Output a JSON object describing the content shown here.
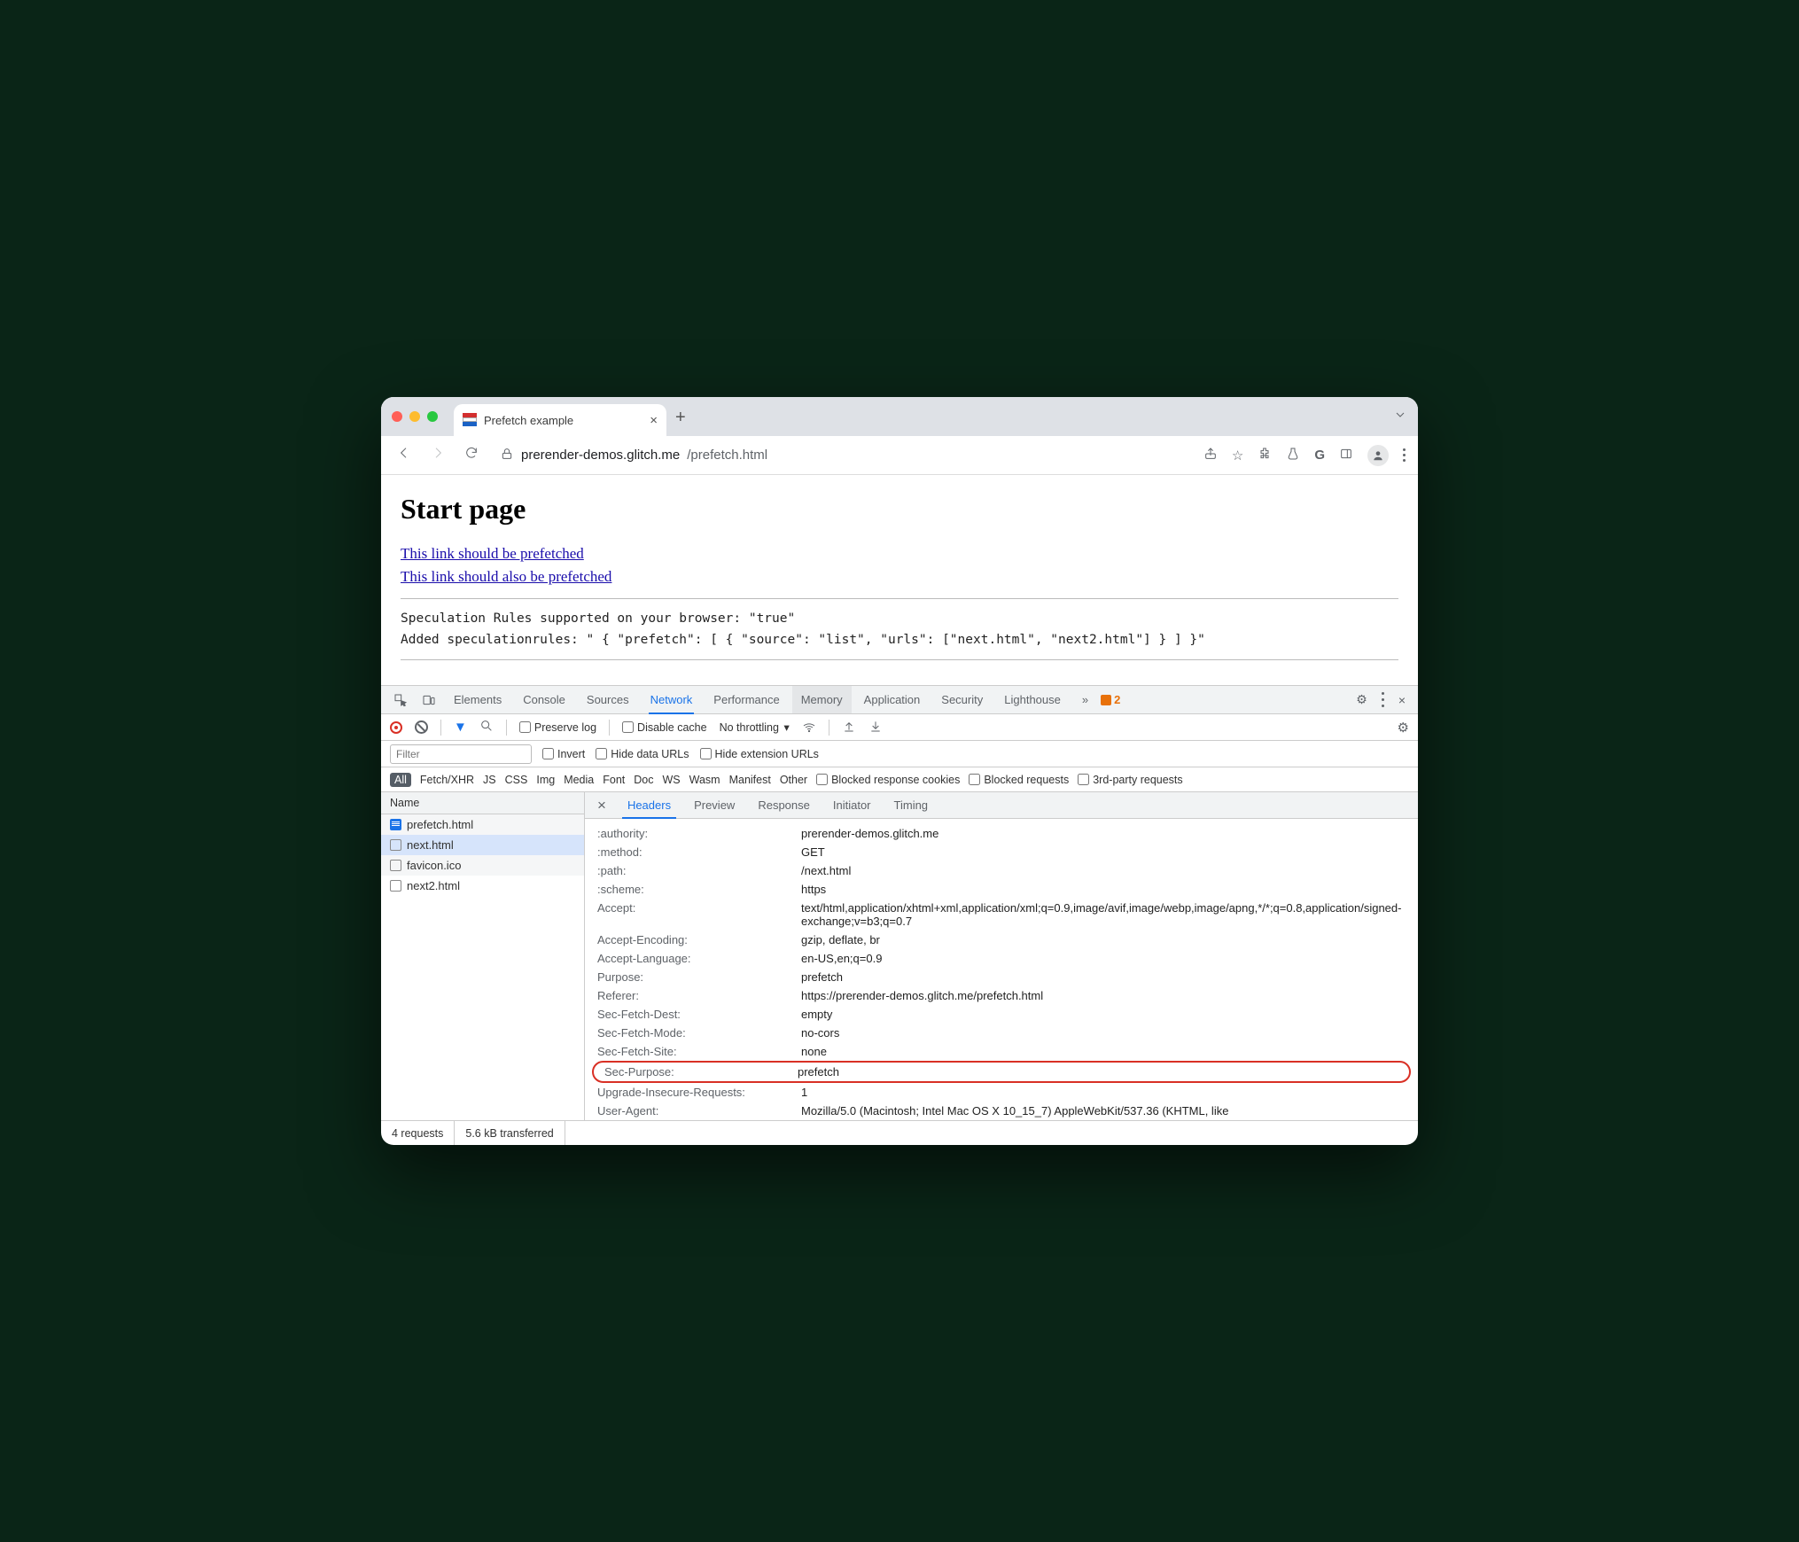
{
  "browser": {
    "tab_title": "Prefetch example",
    "url_host": "prerender-demos.glitch.me",
    "url_path": "/prefetch.html"
  },
  "page": {
    "heading": "Start page",
    "link1": "This link should be prefetched",
    "link2": "This link should also be prefetched",
    "mono1": "Speculation Rules supported on your browser: \"true\"",
    "mono2": "Added speculationrules: \" { \"prefetch\": [ { \"source\": \"list\", \"urls\": [\"next.html\", \"next2.html\"] } ] }\""
  },
  "devtools": {
    "tabs": {
      "elements": "Elements",
      "console": "Console",
      "sources": "Sources",
      "network": "Network",
      "performance": "Performance",
      "memory": "Memory",
      "application": "Application",
      "security": "Security",
      "lighthouse": "Lighthouse"
    },
    "more": "»",
    "warn_count": "2",
    "preserve_log": "Preserve log",
    "disable_cache": "Disable cache",
    "throttling": "No throttling",
    "filter_placeholder": "Filter",
    "invert": "Invert",
    "hide_data": "Hide data URLs",
    "hide_ext": "Hide extension URLs",
    "types": {
      "all": "All",
      "fetchxhr": "Fetch/XHR",
      "js": "JS",
      "css": "CSS",
      "img": "Img",
      "media": "Media",
      "font": "Font",
      "doc": "Doc",
      "ws": "WS",
      "wasm": "Wasm",
      "manifest": "Manifest",
      "other": "Other"
    },
    "blocked_cookies": "Blocked response cookies",
    "blocked_req": "Blocked requests",
    "thirdparty": "3rd-party requests",
    "col_name": "Name",
    "requests": {
      "r0": "prefetch.html",
      "r1": "next.html",
      "r2": "favicon.ico",
      "r3": "next2.html"
    },
    "detail_tabs": {
      "headers": "Headers",
      "preview": "Preview",
      "response": "Response",
      "initiator": "Initiator",
      "timing": "Timing"
    },
    "headers": {
      "authority_k": ":authority:",
      "authority_v": "prerender-demos.glitch.me",
      "method_k": ":method:",
      "method_v": "GET",
      "path_k": ":path:",
      "path_v": "/next.html",
      "scheme_k": ":scheme:",
      "scheme_v": "https",
      "accept_k": "Accept:",
      "accept_v": "text/html,application/xhtml+xml,application/xml;q=0.9,image/avif,image/webp,image/apng,*/*;q=0.8,application/signed-exchange;v=b3;q=0.7",
      "ae_k": "Accept-Encoding:",
      "ae_v": "gzip, deflate, br",
      "al_k": "Accept-Language:",
      "al_v": "en-US,en;q=0.9",
      "purpose_k": "Purpose:",
      "purpose_v": "prefetch",
      "referer_k": "Referer:",
      "referer_v": "https://prerender-demos.glitch.me/prefetch.html",
      "sfd_k": "Sec-Fetch-Dest:",
      "sfd_v": "empty",
      "sfm_k": "Sec-Fetch-Mode:",
      "sfm_v": "no-cors",
      "sfs_k": "Sec-Fetch-Site:",
      "sfs_v": "none",
      "sp_k": "Sec-Purpose:",
      "sp_v": "prefetch",
      "uir_k": "Upgrade-Insecure-Requests:",
      "uir_v": "1",
      "ua_k": "User-Agent:",
      "ua_v": "Mozilla/5.0 (Macintosh; Intel Mac OS X 10_15_7) AppleWebKit/537.36 (KHTML, like"
    },
    "status": {
      "requests": "4 requests",
      "transferred": "5.6 kB transferred"
    }
  }
}
